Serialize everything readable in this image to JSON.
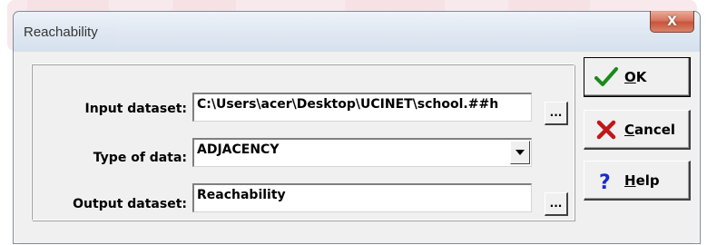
{
  "window": {
    "title": "Reachability",
    "close_glyph": "X"
  },
  "form": {
    "input": {
      "label": "Input dataset:",
      "value": "C:\\Users\\acer\\Desktop\\UCINET\\school.##h",
      "browse": "..."
    },
    "type": {
      "label": "Type of data:",
      "value": "ADJACENCY",
      "arrow_icon": "triangle-down-icon"
    },
    "output": {
      "label": "Output dataset:",
      "value": "Reachability",
      "browse": "..."
    }
  },
  "buttons": {
    "ok": {
      "first": "O",
      "rest": "K",
      "icon": "green-check-icon",
      "color": "#1a8a1a"
    },
    "cancel": {
      "first": "C",
      "rest": "ancel",
      "icon": "red-x-icon",
      "color": "#c01818"
    },
    "help": {
      "first": "H",
      "rest": "elp",
      "icon": "blue-question-icon",
      "color": "#1a2bd0"
    }
  }
}
